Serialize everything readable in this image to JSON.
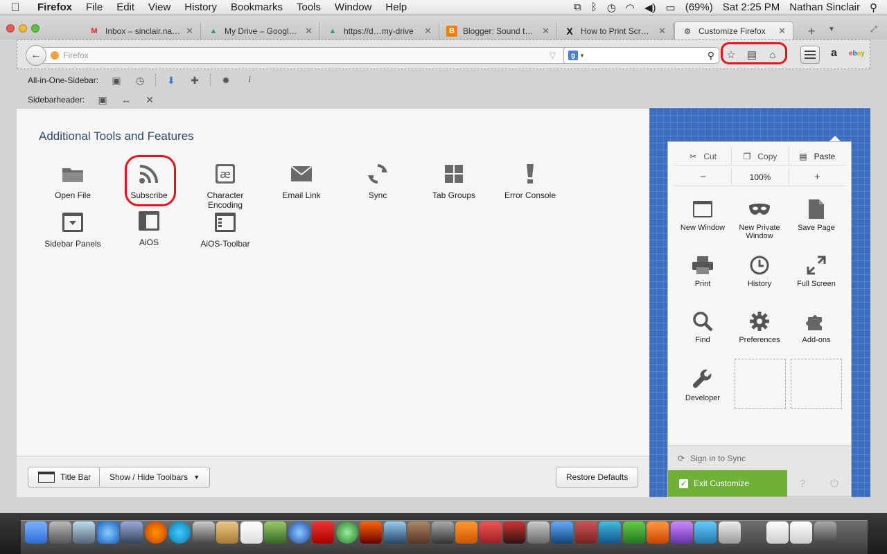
{
  "menubar": {
    "app": "Firefox",
    "items": [
      "File",
      "Edit",
      "View",
      "History",
      "Bookmarks",
      "Tools",
      "Window",
      "Help"
    ],
    "battery": "(69%)",
    "clock": "Sat 2:25 PM",
    "user": "Nathan Sinclair"
  },
  "tabs": [
    {
      "label": "Inbox – sinclair.na…",
      "icon": "gmail-icon"
    },
    {
      "label": "My Drive – Google …",
      "icon": "drive-icon"
    },
    {
      "label": "https://d…my-drive",
      "icon": "drive-icon"
    },
    {
      "label": "Blogger: Sound the…",
      "icon": "blogger-icon"
    },
    {
      "label": "How to Print Scree…",
      "icon": "x-icon"
    },
    {
      "label": "Customize Firefox",
      "icon": "customize-icon"
    }
  ],
  "navbar": {
    "url_placeholder": "Firefox",
    "search_engine": "g"
  },
  "sidebar_toolbar": {
    "label": "All-in-One-Sidebar:"
  },
  "sidebarheader": {
    "label": "Sidebarheader:"
  },
  "palette": {
    "title": "Additional Tools and Features",
    "items": [
      {
        "label": "Open File",
        "icon": "folder-icon"
      },
      {
        "label": "Subscribe",
        "icon": "rss-icon"
      },
      {
        "label": "Character Encoding",
        "icon": "ae-icon"
      },
      {
        "label": "Email Link",
        "icon": "envelope-icon"
      },
      {
        "label": "Sync",
        "icon": "sync-icon"
      },
      {
        "label": "Tab Groups",
        "icon": "tab-groups-icon"
      },
      {
        "label": "Error Console",
        "icon": "exclamation-icon"
      },
      {
        "label": "Sidebar Panels",
        "icon": "sidebar-panels-icon"
      },
      {
        "label": "AiOS",
        "icon": "aios-icon"
      },
      {
        "label": "AiOS-Toolbar",
        "icon": "aios-toolbar-icon"
      }
    ]
  },
  "bottom": {
    "title_bar": "Title Bar",
    "show_hide": "Show / Hide Toolbars",
    "restore": "Restore Defaults"
  },
  "menu_panel": {
    "cut": "Cut",
    "copy": "Copy",
    "paste": "Paste",
    "zoom_minus": "−",
    "zoom": "100%",
    "zoom_plus": "+",
    "items": [
      {
        "label": "New Window",
        "icon": "new-window-icon"
      },
      {
        "label": "New Private Window",
        "icon": "mask-icon"
      },
      {
        "label": "Save Page",
        "icon": "page-icon"
      },
      {
        "label": "Print",
        "icon": "printer-icon"
      },
      {
        "label": "History",
        "icon": "clock-icon"
      },
      {
        "label": "Full Screen",
        "icon": "fullscreen-icon"
      },
      {
        "label": "Find",
        "icon": "magnifier-icon"
      },
      {
        "label": "Preferences",
        "icon": "gear-icon"
      },
      {
        "label": "Add-ons",
        "icon": "puzzle-icon"
      },
      {
        "label": "Developer",
        "icon": "wrench-icon"
      }
    ],
    "sign_in": "Sign in to Sync",
    "exit": "Exit Customize"
  },
  "colors": {
    "accent_blue": "#3c6fc2",
    "exit_green": "#6fb136",
    "annotation_red": "#e8101a",
    "title_blue": "#2e4b6b"
  }
}
